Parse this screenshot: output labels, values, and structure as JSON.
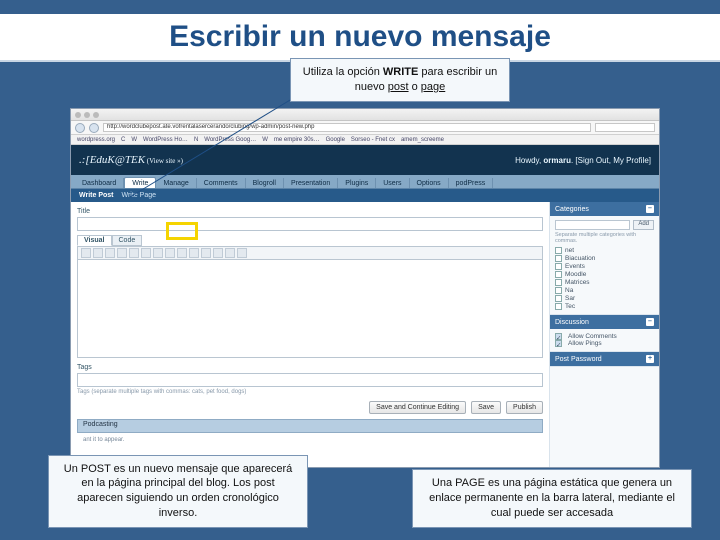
{
  "title": "Escribir un nuevo mensaje",
  "callouts": {
    "top": "Utiliza la opción WRITE para escribir un nuevo post o page",
    "bl": "Un POST es un nuevo mensaje que aparecerá en la página principal del blog. Los post aparecen siguiendo un orden cronológico inverso.",
    "br": "Una PAGE es una página estática que genera un enlace permanente en la barra lateral, mediante el cual puede ser accesada"
  },
  "browser": {
    "url": "http://wordclubepost.ate.vofrentalasercerando/clubing/wp-admin/post-new.php",
    "bookmarks": [
      "wordpress.org",
      "C",
      "W",
      "WordPress Ho…",
      "N",
      "WordPress Goog…",
      "W",
      "me empire 30s…",
      "Google",
      "Sorseo - Fnet cx",
      "amem_screeme"
    ]
  },
  "wp": {
    "site": ".:[EduK@TEK",
    "site_sub": " (View site »)",
    "howdy_pre": "Howdy, ",
    "howdy_user": "ormaru",
    "howdy_post": ". [Sign Out, My Profile]",
    "nav": [
      "Dashboard",
      "Write",
      "Manage",
      "Comments",
      "Blogroll",
      "Presentation",
      "Plugins",
      "Users",
      "Options",
      "podPress"
    ],
    "subnav": [
      "Write Post",
      "Write Page"
    ],
    "titleLabel": "Title",
    "edTabs": [
      "Visual",
      "Code"
    ],
    "tagsLabel": "Tags",
    "tagsHelp": "Tags (separate multiple tags with commas: cats, pet food, dogs)",
    "buttons": [
      "Save and Continue Editing",
      "Save",
      "Publish"
    ],
    "pod": "Podcasting",
    "appearHint": "ant it to appear."
  },
  "side": {
    "catHead": "Categories",
    "add": "Add",
    "catHint": "Separate multiple categories with commas.",
    "cats": [
      "net",
      "Biacuation",
      "Events",
      "Moodle",
      "Matrices",
      "Na",
      "Sar",
      "Tec"
    ],
    "discHead": "Discussion",
    "disc": [
      "Allow Comments",
      "Allow Pings"
    ],
    "passHead": "Post Password"
  }
}
